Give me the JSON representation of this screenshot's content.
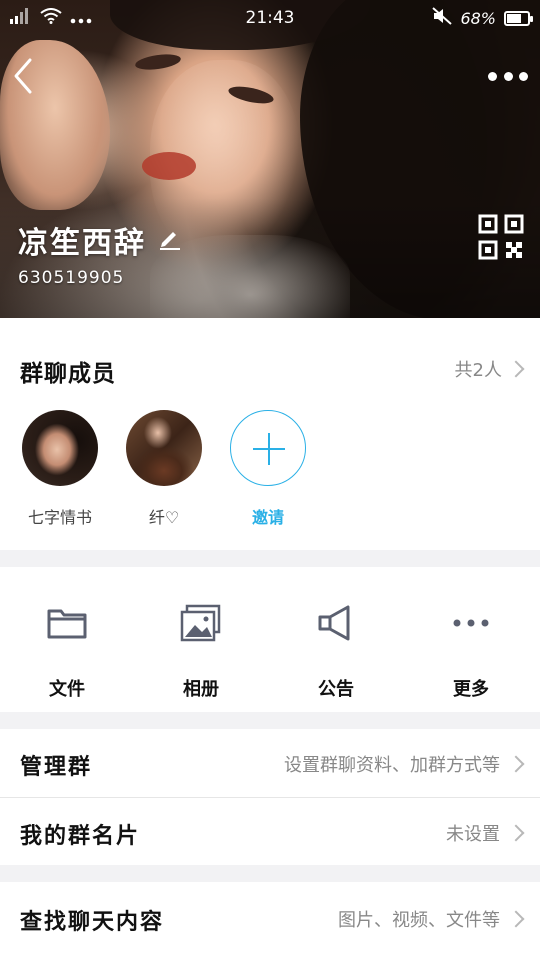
{
  "status_bar": {
    "time": "21:43",
    "battery": "68%",
    "battery_level": 0.68,
    "icons": [
      "signal-icon",
      "wifi-icon",
      "notification-dots-icon",
      "mute-icon",
      "battery-icon"
    ]
  },
  "header": {
    "group_name": "凉笙西辞",
    "group_id": "630519905",
    "icons": [
      "back-icon",
      "more-icon",
      "edit-icon",
      "qr-code-icon"
    ]
  },
  "members": {
    "title": "群聊成员",
    "count_label": "共2人",
    "list": [
      {
        "name": "七字情书"
      },
      {
        "name": "纤♡"
      }
    ],
    "invite_label": "邀请"
  },
  "tools": [
    {
      "label": "文件",
      "icon": "folder-icon"
    },
    {
      "label": "相册",
      "icon": "album-icon"
    },
    {
      "label": "公告",
      "icon": "announcement-icon"
    },
    {
      "label": "更多",
      "icon": "more-dots-icon"
    }
  ],
  "settings": {
    "manage": {
      "title": "管理群",
      "value": "设置群聊资料、加群方式等"
    },
    "card": {
      "title": "我的群名片",
      "value": "未设置"
    },
    "search": {
      "title": "查找聊天内容",
      "value": "图片、视频、文件等"
    }
  },
  "colors": {
    "accent": "#2ab0e6",
    "background": "#f2f2f4",
    "icon_gray": "#5b6070"
  }
}
